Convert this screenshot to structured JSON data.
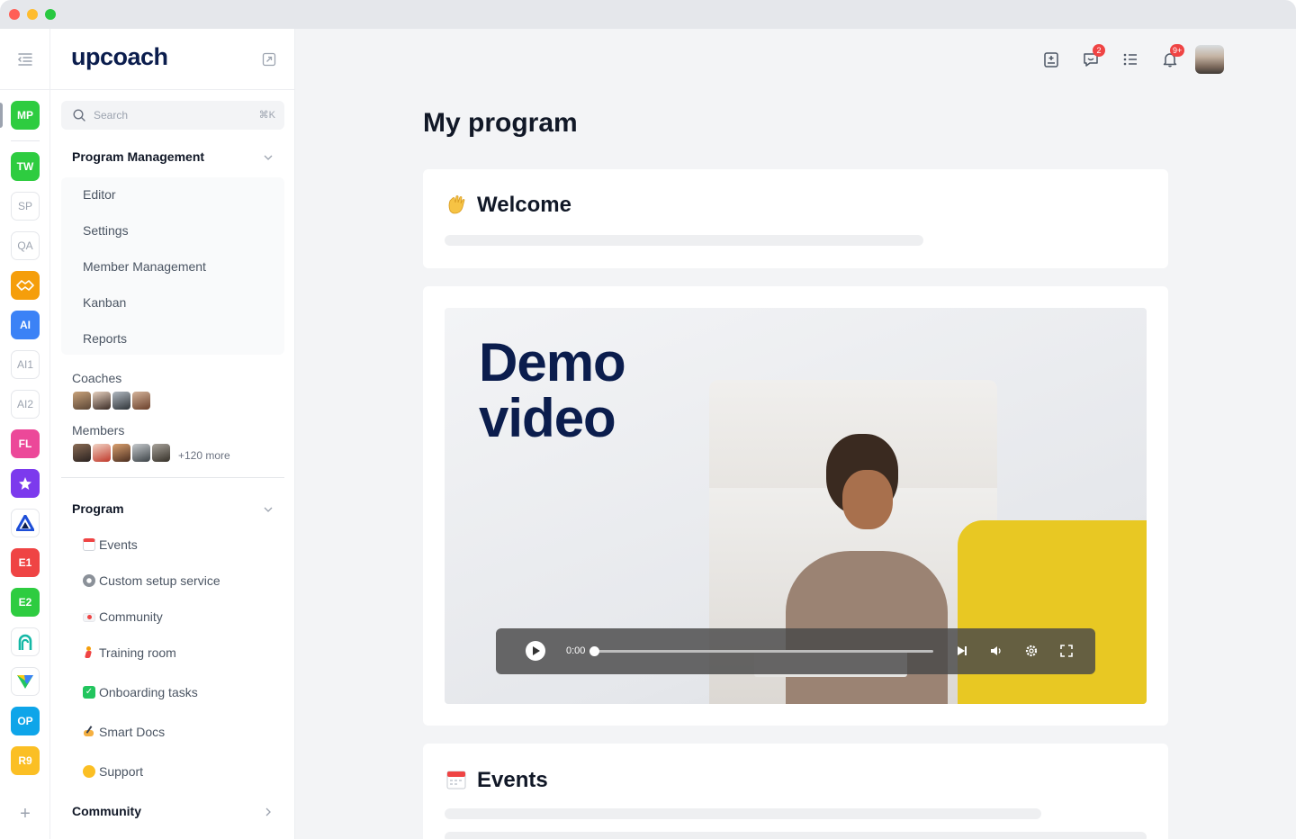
{
  "app": {
    "logo": "upcoach"
  },
  "colors": {
    "brand_navy": "#0b1d4d",
    "accent_yellow": "#e8c823",
    "badge_red": "#ef4444"
  },
  "rail": {
    "items": [
      {
        "label": "MP",
        "color": "#2ecc40"
      },
      {
        "label": "TW",
        "color": "#2ecc40"
      },
      {
        "label": "SP",
        "color": ""
      },
      {
        "label": "QA",
        "color": ""
      },
      {
        "label": "",
        "icon": "handshake-icon",
        "color": "#f59e0b"
      },
      {
        "label": "AI",
        "color": "#3b82f6"
      },
      {
        "label": "AI1",
        "color": ""
      },
      {
        "label": "AI2",
        "color": ""
      },
      {
        "label": "FL",
        "color": "#ec4899"
      },
      {
        "label": "",
        "icon": "star-icon",
        "color": "#7c3aed"
      },
      {
        "label": "",
        "icon": "triangle-logo-icon",
        "color": ""
      },
      {
        "label": "E1",
        "color": "#ef4444"
      },
      {
        "label": "E2",
        "color": "#2ecc40"
      },
      {
        "label": "",
        "icon": "a-logo-icon",
        "color": ""
      },
      {
        "label": "",
        "icon": "v-logo-icon",
        "color": ""
      },
      {
        "label": "OP",
        "color": "#0ea5e9"
      },
      {
        "label": "R9",
        "color": "#fbbf24"
      }
    ],
    "add": "+"
  },
  "sidebar": {
    "search": {
      "placeholder": "Search",
      "shortcut": "⌘K"
    },
    "program_management": {
      "title": "Program Management",
      "items": [
        "Editor",
        "Settings",
        "Member Management",
        "Kanban",
        "Reports"
      ]
    },
    "coaches_label": "Coaches",
    "members_label": "Members",
    "members_more": "+120 more",
    "program": {
      "title": "Program",
      "items": [
        {
          "label": "Events",
          "icon": "calendar-icon"
        },
        {
          "label": "Custom setup service",
          "icon": "gear-icon"
        },
        {
          "label": "Community",
          "icon": "heart-letter-icon"
        },
        {
          "label": "Training room",
          "icon": "runner-icon"
        },
        {
          "label": "Onboarding tasks",
          "icon": "check-box-icon"
        },
        {
          "label": "Smart Docs",
          "icon": "writing-hand-icon"
        },
        {
          "label": "Support",
          "icon": "smile-icon"
        }
      ]
    },
    "community": {
      "title": "Community"
    }
  },
  "header": {
    "chat_badge": "2",
    "notification_badge": "9+"
  },
  "main": {
    "title": "My program",
    "welcome": {
      "title": "Welcome",
      "emoji": "wave-icon"
    },
    "video": {
      "overlay_line1": "Demo",
      "overlay_line2": "video",
      "time": "0:00",
      "progress": 0
    },
    "events": {
      "title": "Events",
      "emoji": "calendar-icon"
    }
  }
}
